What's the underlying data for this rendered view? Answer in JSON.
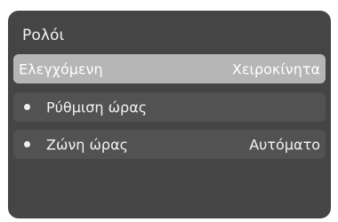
{
  "panel": {
    "title": "Ρολόι"
  },
  "menu": {
    "items": [
      {
        "label": "Ελεγχόμενη",
        "value": "Χειροκίνητα",
        "selected": true
      },
      {
        "label": "Ρύθμιση ώρας",
        "value": ""
      },
      {
        "label": "Ζώνη ώρας",
        "value": "Αυτόματο"
      }
    ]
  },
  "colors": {
    "panel_bg": "#454545",
    "selected_row_bg": "#b5b5b5",
    "row_bg": "#525252",
    "text": "#f4f4f4"
  }
}
